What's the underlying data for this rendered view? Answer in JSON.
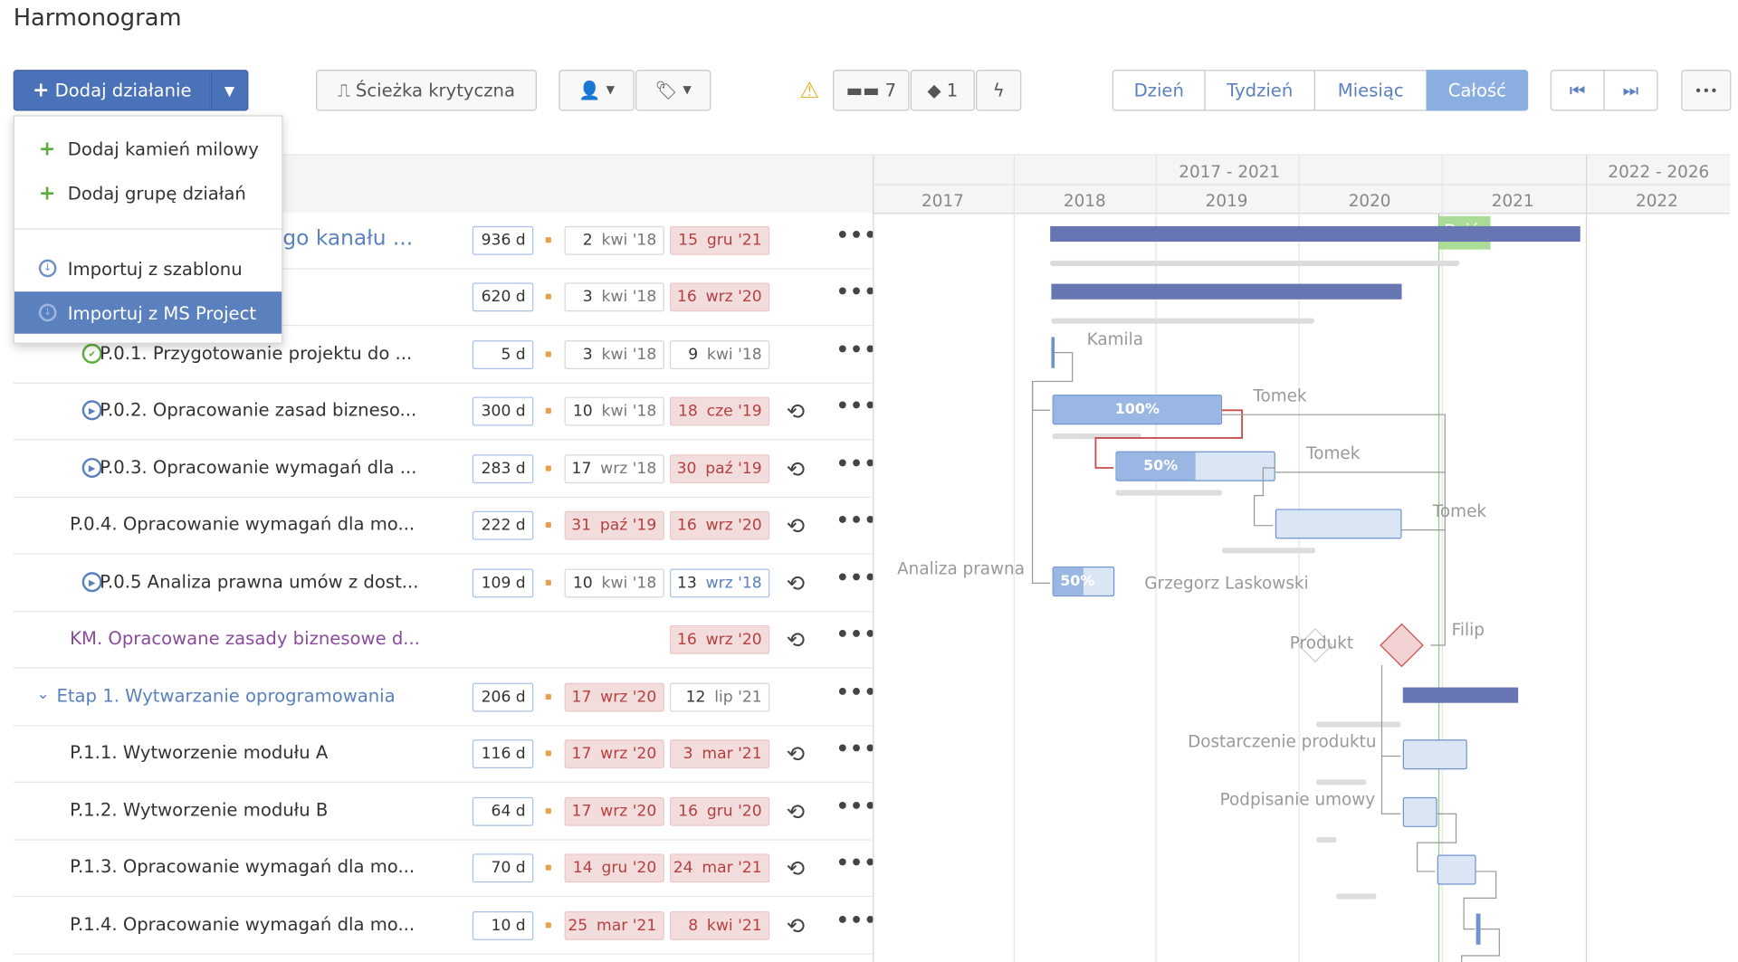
{
  "page": {
    "title": "Harmonogram"
  },
  "toolbar": {
    "add_label": "Dodaj działanie",
    "critical_label": "Ścieżka krytyczna",
    "links_count": "7",
    "milestones_count": "1",
    "views": [
      "Dzień",
      "Tydzień",
      "Miesiąc",
      "Całość"
    ],
    "active_view": "Całość",
    "more": "•••"
  },
  "dropdown": {
    "items": [
      "Dodaj kamień milowy",
      "Dodaj grupę działań",
      "Importuj z szablonu",
      "Importuj z MS Project"
    ]
  },
  "timeline": {
    "groups": [
      "2017 - 2021",
      "2022 - 2026"
    ],
    "years": [
      "2017",
      "2018",
      "2019",
      "2020",
      "2021",
      "2022"
    ],
    "today": "Dziś"
  },
  "rows": [
    {
      "label": "go kanału ...",
      "dur": "936 d",
      "s_d": "2",
      "s_m": "kwi '18",
      "e_d": "15",
      "e_m": "gru '21"
    },
    {
      "label": "",
      "dur": "620 d",
      "s_d": "3",
      "s_m": "kwi '18",
      "e_d": "16",
      "e_m": "wrz '20"
    },
    {
      "label": "P.0.1. Przygotowanie projektu do ...",
      "dur": "5 d",
      "s_d": "3",
      "s_m": "kwi '18",
      "e_d": "9",
      "e_m": "kwi '18"
    },
    {
      "label": "P.0.2. Opracowanie zasad bizneso...",
      "dur": "300 d",
      "s_d": "10",
      "s_m": "kwi '18",
      "e_d": "18",
      "e_m": "cze '19"
    },
    {
      "label": "P.0.3. Opracowanie wymagań dla ...",
      "dur": "283 d",
      "s_d": "17",
      "s_m": "wrz '18",
      "e_d": "30",
      "e_m": "paź '19"
    },
    {
      "label": "P.0.4. Opracowanie wymagań dla mo...",
      "dur": "222 d",
      "s_d": "31",
      "s_m": "paź '19",
      "e_d": "16",
      "e_m": "wrz '20"
    },
    {
      "label": "P.0.5 Analiza prawna umów z dost...",
      "dur": "109 d",
      "s_d": "10",
      "s_m": "kwi '18",
      "e_d": "13",
      "e_m": "wrz '18"
    },
    {
      "label": "KM. Opracowane zasady biznesowe d...",
      "dur": "",
      "s_d": "",
      "s_m": "",
      "e_d": "16",
      "e_m": "wrz '20"
    },
    {
      "label": "Etap 1. Wytwarzanie oprogramowania",
      "dur": "206 d",
      "s_d": "17",
      "s_m": "wrz '20",
      "e_d": "12",
      "e_m": "lip '21"
    },
    {
      "label": "P.1.1. Wytworzenie modułu A",
      "dur": "116 d",
      "s_d": "17",
      "s_m": "wrz '20",
      "e_d": "3",
      "e_m": "mar '21"
    },
    {
      "label": "P.1.2. Wytworzenie modułu B",
      "dur": "64 d",
      "s_d": "17",
      "s_m": "wrz '20",
      "e_d": "16",
      "e_m": "gru '20"
    },
    {
      "label": "P.1.3. Opracowanie wymagań dla mo...",
      "dur": "70 d",
      "s_d": "14",
      "s_m": "gru '20",
      "e_d": "24",
      "e_m": "mar '21"
    },
    {
      "label": "P.1.4. Opracowanie wymagań dla mo...",
      "dur": "10 d",
      "s_d": "25",
      "s_m": "mar '21",
      "e_d": "8",
      "e_m": "kwi '21"
    }
  ],
  "gantt": {
    "p1": "100%",
    "p2": "50%",
    "p3": "50%",
    "names": [
      "Kamila",
      "Tomek",
      "Tomek",
      "Tomek",
      "Analiza prawna",
      "Grzegorz Laskowski",
      "Produkt",
      "Filip",
      "Dostarczenie produktu",
      "Podpisanie umowy"
    ]
  }
}
